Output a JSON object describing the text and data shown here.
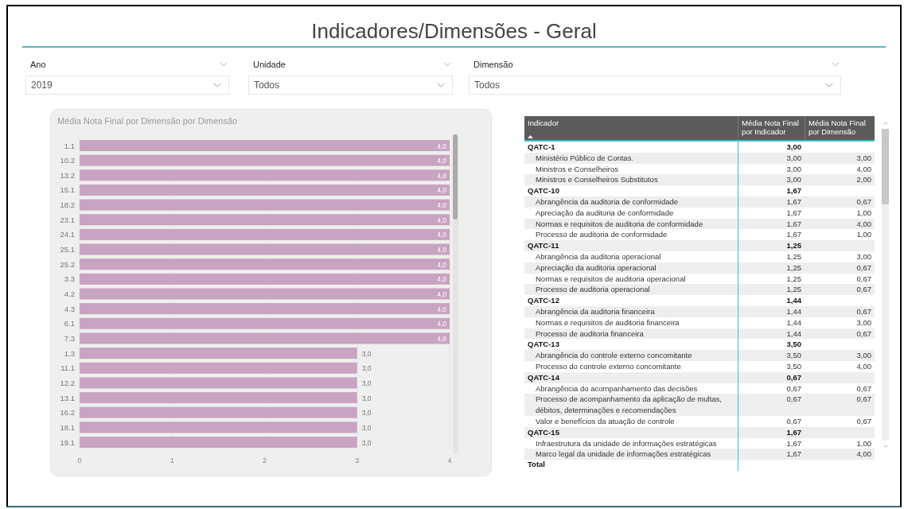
{
  "title": "Indicadores/Dimensões - Geral",
  "filters": [
    {
      "label": "Ano",
      "value": "2019"
    },
    {
      "label": "Unidade",
      "value": "Todos"
    },
    {
      "label": "Dimensão",
      "value": "Todos"
    }
  ],
  "chart": {
    "chart_data": {
      "type": "bar",
      "orientation": "horizontal",
      "title": "Média Nota Final por Dimensão por Dimensão",
      "categories": [
        "1.1",
        "10.2",
        "13.2",
        "15.1",
        "18.2",
        "23.1",
        "24.1",
        "25.1",
        "25.2",
        "3.3",
        "4.2",
        "4.3",
        "6.1",
        "7.3",
        "1.3",
        "11.1",
        "12.2",
        "13.1",
        "16.2",
        "18.1",
        "19.1"
      ],
      "series": [
        {
          "color": "#c9a3c2",
          "values": [
            4,
            4,
            4,
            4,
            4,
            4,
            4,
            4,
            4,
            4,
            4,
            4,
            4,
            4,
            3,
            3,
            3,
            3,
            3,
            3,
            3
          ]
        }
      ],
      "value_labels": [
        "4,0",
        "4,0",
        "4,0",
        "4,0",
        "4,0",
        "4,0",
        "4,0",
        "4,0",
        "4,0",
        "4,0",
        "4,0",
        "4,0",
        "4,0",
        "4,0",
        "3,0",
        "3,0",
        "3,0",
        "3,0",
        "3,0",
        "3,0",
        "3,0"
      ],
      "xlim": [
        0,
        4
      ],
      "xticks": [
        0,
        1,
        2,
        3,
        4
      ],
      "grid": true
    }
  },
  "table": {
    "columns": [
      "Indicador",
      "Média Nota Final por Indicador",
      "Média Nota Final por Dimensão"
    ],
    "groups": [
      {
        "indicador": "QATC-1",
        "media": "3,00",
        "rows": [
          {
            "indicador": "Ministério Público de Contas.",
            "media_indicador": "3,00",
            "media_dimensao": "3,00"
          },
          {
            "indicador": "Ministros e Conselheiros",
            "media_indicador": "3,00",
            "media_dimensao": "4,00"
          },
          {
            "indicador": "Ministros e Conselheiros Substitutos",
            "media_indicador": "3,00",
            "media_dimensao": "2,00"
          }
        ]
      },
      {
        "indicador": "QATC-10",
        "media": "1,67",
        "rows": [
          {
            "indicador": "Abrangência da auditoria de conformidade",
            "media_indicador": "1,67",
            "media_dimensao": "0,67"
          },
          {
            "indicador": "Apreciação da auditoria de conformidade",
            "media_indicador": "1,67",
            "media_dimensao": "1,00"
          },
          {
            "indicador": "Normas e requisitos de auditoria de conformidade",
            "media_indicador": "1,67",
            "media_dimensao": "4,00"
          },
          {
            "indicador": "Processo de auditoria de conformidade",
            "media_indicador": "1,67",
            "media_dimensao": "1,00"
          }
        ]
      },
      {
        "indicador": "QATC-11",
        "media": "1,25",
        "rows": [
          {
            "indicador": "Abrangência da auditoria operacional",
            "media_indicador": "1,25",
            "media_dimensao": "3,00"
          },
          {
            "indicador": "Apreciação da auditoria operacional",
            "media_indicador": "1,25",
            "media_dimensao": "0,67"
          },
          {
            "indicador": "Normas e requisitos de auditoria operacional",
            "media_indicador": "1,25",
            "media_dimensao": "0,67"
          },
          {
            "indicador": "Processo de auditoria operacional",
            "media_indicador": "1,25",
            "media_dimensao": "0,67"
          }
        ]
      },
      {
        "indicador": "QATC-12",
        "media": "1,44",
        "rows": [
          {
            "indicador": "Abrangência da auditoria financeira",
            "media_indicador": "1,44",
            "media_dimensao": "0,67"
          },
          {
            "indicador": "Normas e requisitos de auditoria financeira",
            "media_indicador": "1,44",
            "media_dimensao": "3,00"
          },
          {
            "indicador": "Processo de auditoria financeira",
            "media_indicador": "1,44",
            "media_dimensao": "0,67"
          }
        ]
      },
      {
        "indicador": "QATC-13",
        "media": "3,50",
        "rows": [
          {
            "indicador": "Abrangência do controle externo concomitante",
            "media_indicador": "3,50",
            "media_dimensao": "3,00"
          },
          {
            "indicador": "Processo do controle externo concomitante",
            "media_indicador": "3,50",
            "media_dimensao": "4,00"
          }
        ]
      },
      {
        "indicador": "QATC-14",
        "media": "0,67",
        "rows": [
          {
            "indicador": "Abrangência do acompanhamento das decisões",
            "media_indicador": "0,67",
            "media_dimensao": "0,67"
          },
          {
            "indicador": "Processo de acompanhamento da aplicação de multas, débitos, determinações e recomendações",
            "media_indicador": "0,67",
            "media_dimensao": "0,67"
          },
          {
            "indicador": "Valor e benefícios da atuação de controle",
            "media_indicador": "0,67",
            "media_dimensao": "0,67"
          }
        ]
      },
      {
        "indicador": "QATC-15",
        "media": "1,67",
        "rows": [
          {
            "indicador": "Infraestrutura da unidade de informações estratégicas",
            "media_indicador": "1,67",
            "media_dimensao": "1,00"
          },
          {
            "indicador": "Marco legal da unidade de informações estratégicas",
            "media_indicador": "1,67",
            "media_dimensao": "4,00"
          }
        ]
      }
    ],
    "total": "Total"
  }
}
